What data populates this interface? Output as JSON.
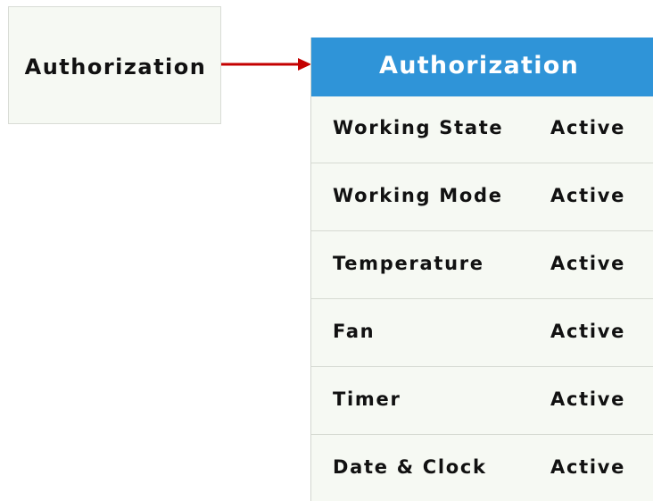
{
  "source_label": "Authorization",
  "panel": {
    "title": "Authorization",
    "items": [
      {
        "name": "Working State",
        "status": "Active"
      },
      {
        "name": "Working Mode",
        "status": "Active"
      },
      {
        "name": "Temperature",
        "status": "Active"
      },
      {
        "name": "Fan",
        "status": "Active"
      },
      {
        "name": "Timer",
        "status": "Active"
      },
      {
        "name": "Date & Clock",
        "status": "Active"
      }
    ]
  },
  "colors": {
    "header": "#2f94d8",
    "arrow": "#c40000",
    "background": "#f6f9f3"
  },
  "icons": {
    "connector": "right-arrow-icon"
  }
}
